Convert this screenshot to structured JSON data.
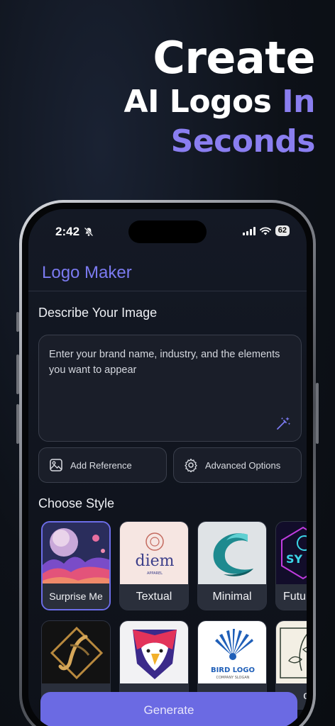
{
  "headline": {
    "line1": "Create",
    "line2_part1": "AI Logos ",
    "line2_part2": "In",
    "line3": "Seconds"
  },
  "status": {
    "time": "2:42",
    "battery": "62"
  },
  "app": {
    "title": "Logo Maker"
  },
  "describe": {
    "label": "Describe Your Image",
    "placeholder": "Enter your brand name, industry, and the elements you want to appear"
  },
  "options": {
    "add_reference": "Add Reference",
    "advanced_options": "Advanced Options"
  },
  "styles": {
    "label": "Choose Style",
    "items": [
      {
        "label": "Surprise Me",
        "selected": true
      },
      {
        "label": "Textual"
      },
      {
        "label": "Minimal"
      },
      {
        "label": "Futu"
      },
      {
        "label": ""
      },
      {
        "label": ""
      },
      {
        "label": ""
      },
      {
        "label": "on"
      }
    ],
    "thumb_text": {
      "textual": "diem",
      "textual_sub": "APPAREL",
      "bird_logo": "BIRD LOGO",
      "bird_slogan": "COMPANY SLOGAN",
      "futuristic": "SY"
    }
  },
  "generate_label": "Generate",
  "colors": {
    "accent": "#6b6ae3",
    "headline_accent": "#8a7ef0"
  }
}
